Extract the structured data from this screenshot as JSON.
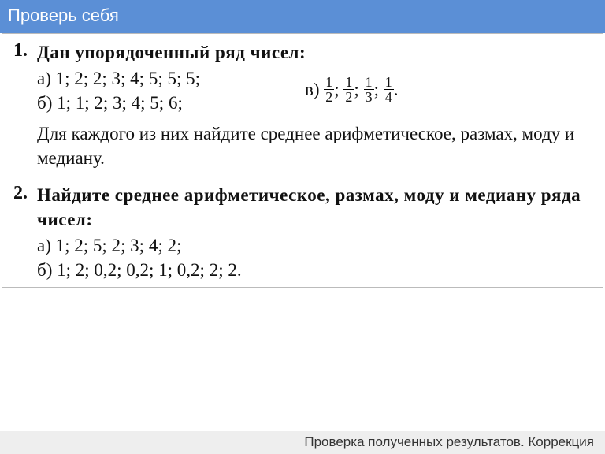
{
  "header": {
    "title": "Проверь себя"
  },
  "p1": {
    "num": "1.",
    "lead": "Дан упорядоченный ряд чисел:",
    "a": "а) 1; 2; 2; 3; 4; 5; 5; 5;",
    "b": "б) 1; 1; 2; 3; 4; 5; 6;",
    "v_label": "в)",
    "v_sep1": ";",
    "v_sep2": ";",
    "v_sep3": ";",
    "v_end": ".",
    "f1_top": "1",
    "f1_bot": "2",
    "f2_top": "1",
    "f2_bot": "2",
    "f3_top": "1",
    "f3_bot": "3",
    "f4_top": "1",
    "f4_bot": "4",
    "tail": "Для каждого из них найдите среднее арифметическое, размах, моду и медиану."
  },
  "p2": {
    "num": "2.",
    "lead": "Найдите среднее арифметическое, размах, моду и ме­диану ряда чисел:",
    "a": "а) 1; 2; 5; 2; 3; 4; 2;",
    "b": "б) 1; 2; 0,2; 0,2; 1; 0,2; 2; 2."
  },
  "footer": {
    "text": "Проверка полученных результатов. Коррекция"
  }
}
